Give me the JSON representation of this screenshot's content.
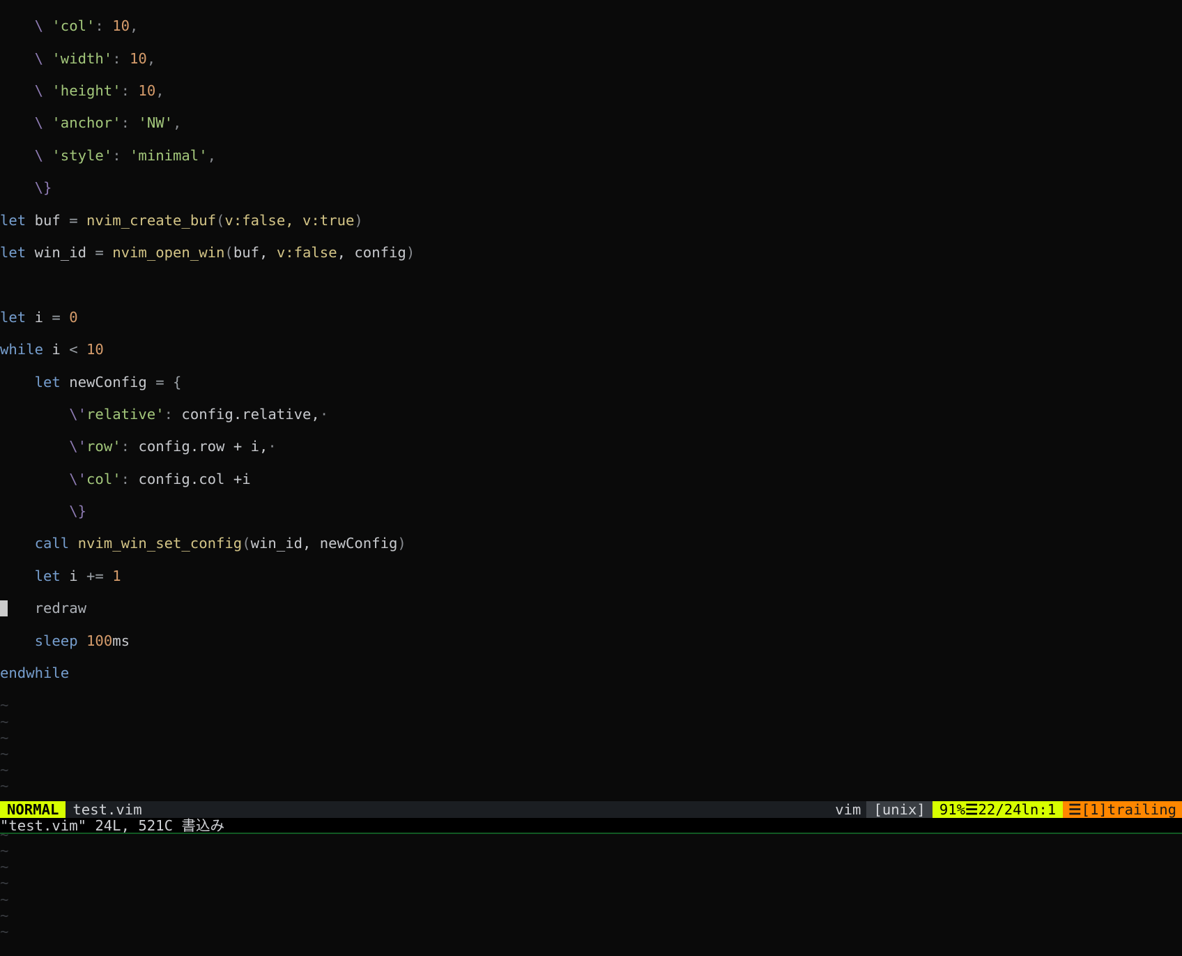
{
  "code": {
    "l1": {
      "esc": "    \\ ",
      "key": "'col'",
      "colon": ": ",
      "val": "10",
      "comma": ","
    },
    "l2": {
      "esc": "    \\ ",
      "key": "'width'",
      "colon": ": ",
      "val": "10",
      "comma": ","
    },
    "l3": {
      "esc": "    \\ ",
      "key": "'height'",
      "colon": ": ",
      "val": "10",
      "comma": ","
    },
    "l4": {
      "esc": "    \\ ",
      "key": "'anchor'",
      "colon": ": ",
      "val": "'NW'",
      "comma": ","
    },
    "l5": {
      "esc": "    \\ ",
      "key": "'style'",
      "colon": ": ",
      "val": "'minimal'",
      "comma": ","
    },
    "l6": {
      "esc": "    \\}",
      "rest": ""
    },
    "l7": {
      "let": "let ",
      "id": "buf ",
      "eq": "= ",
      "fn": "nvim_create_buf",
      "lp": "(",
      "arg": "v:false, v:true",
      "rp": ")"
    },
    "l8": {
      "let": "let ",
      "id": "win_id ",
      "eq": "= ",
      "fn": "nvim_open_win",
      "lp": "(",
      "args_pre": "buf, ",
      "arg_s": "v:false",
      "args_post": ", config",
      "rp": ")"
    },
    "l9": "",
    "l10": {
      "let": "let ",
      "id": "i ",
      "eq": "= ",
      "val": "0"
    },
    "l11": {
      "kw": "while ",
      "expr_a": "i ",
      "op": "< ",
      "val": "10"
    },
    "l12": {
      "pad": "    ",
      "let": "let ",
      "id": "newConfig ",
      "eq": "= {"
    },
    "l13": {
      "pad": "        ",
      "esc": "\\'",
      "key": "relative'",
      "colon": ": ",
      "expr": "config.relative,",
      "trail": "·"
    },
    "l14": {
      "pad": "        ",
      "esc": "\\'",
      "key": "row'",
      "colon": ": ",
      "expr": "config.row + i,",
      "trail": "·"
    },
    "l15": {
      "pad": "        ",
      "esc": "\\'",
      "key": "col'",
      "colon": ": ",
      "expr": "config.col +i"
    },
    "l16": {
      "pad": "        ",
      "esc": "\\}"
    },
    "l17": {
      "pad": "    ",
      "kw": "call ",
      "fn": "nvim_win_set_config",
      "lp": "(",
      "args": "win_id, newConfig",
      "rp": ")"
    },
    "l18": {
      "pad": "    ",
      "let": "let ",
      "id": "i ",
      "op": "+= ",
      "val": "1"
    },
    "l19": {
      "pad": "    ",
      "kw": "redraw"
    },
    "l20": {
      "pad": "    ",
      "kw": "sleep ",
      "val": "100",
      "unit": "ms"
    },
    "l21": {
      "kw": "endwhile"
    }
  },
  "tilde": "~",
  "empty_lines": 15,
  "status": {
    "mode": " NORMAL ",
    "filename": "test.vim",
    "filetype": "vim",
    "encoding": "[unix]",
    "percent": "91%",
    "sep": "☰",
    "lines": "22/24",
    "ln_label": "ln",
    "colon": ":",
    "col": "1",
    "warn_glyph": "☰",
    "warn_text": "[1]trailing"
  },
  "cmdline": "\"test.vim\" 24L, 521C 書込み"
}
